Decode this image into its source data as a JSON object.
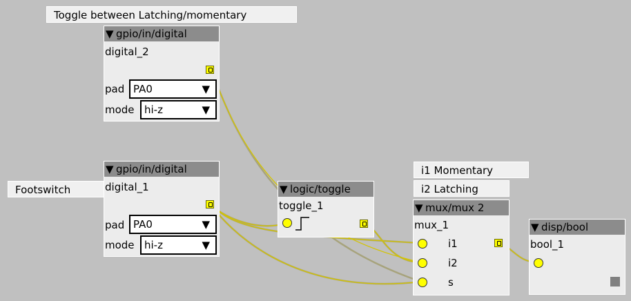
{
  "comments": {
    "top": "Toggle between Latching/momentary",
    "footswitch": "Footswitch",
    "mux_i1": "i1 Momentary",
    "mux_i2": "i2 Latching"
  },
  "objects": {
    "gpio2": {
      "type": "gpio/in/digital",
      "name": "digital_2",
      "pad_label": "pad",
      "pad_value": "PA0",
      "mode_label": "mode",
      "mode_value": "hi-z"
    },
    "gpio1": {
      "type": "gpio/in/digital",
      "name": "digital_1",
      "pad_label": "pad",
      "pad_value": "PA0",
      "mode_label": "mode",
      "mode_value": "hi-z"
    },
    "toggle": {
      "type": "logic/toggle",
      "name": "toggle_1"
    },
    "mux": {
      "type": "mux/mux 2",
      "name": "mux_1",
      "in1": "i1",
      "in2": "i2",
      "in3": "s"
    },
    "disp": {
      "type": "disp/bool",
      "name": "bool_1"
    }
  },
  "icons": {
    "collapse": "triangle-down-icon",
    "dropdown": "triangle-down-icon",
    "outlet": "outlet-port-icon",
    "inlet": "inlet-port-icon"
  },
  "colors": {
    "canvas": "#c0c0c0",
    "object_body": "#ececec",
    "object_header": "#8c8c8c",
    "port": "#ffff00",
    "wire": "#d4c400"
  }
}
